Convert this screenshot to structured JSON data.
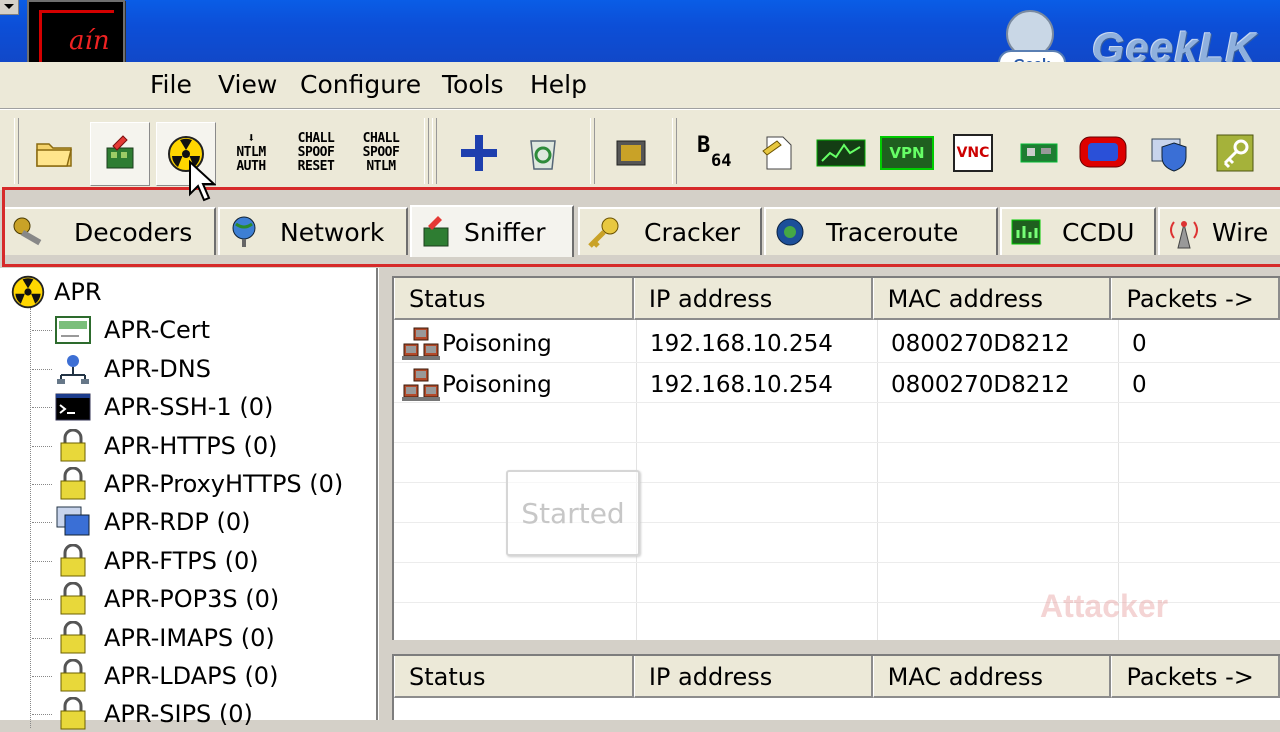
{
  "app": {
    "logo_text": "aín"
  },
  "watermark": {
    "badge": "Geek",
    "brand": "GeekLK"
  },
  "menu": {
    "items": [
      "File",
      "View",
      "Configure",
      "Tools",
      "Help"
    ]
  },
  "toolbar": {
    "buttons": [
      {
        "name": "open-folder",
        "icon": "folder-icon"
      },
      {
        "name": "start-stop-sniffer",
        "icon": "sniffer-icon",
        "pressed": true
      },
      {
        "name": "start-stop-apr",
        "icon": "radiation-icon",
        "pressed": true
      },
      {
        "name": "ntlm-auth",
        "icon": "text-icon",
        "text": [
          "NTLM",
          "AUTH"
        ]
      },
      {
        "name": "chall-spoof-reset",
        "icon": "text-icon",
        "text": [
          "CHALL",
          "SPOOF",
          "RESET"
        ]
      },
      {
        "name": "chall-spoof-ntlm",
        "icon": "text-icon",
        "text": [
          "CHALL",
          "SPOOF",
          "NTLM"
        ]
      },
      {
        "name": "add",
        "icon": "plus-icon"
      },
      {
        "name": "recycle",
        "icon": "recycle-icon"
      },
      {
        "name": "chip",
        "icon": "chip-icon"
      },
      {
        "name": "base64",
        "icon": "b64-icon",
        "text": [
          "B",
          "64"
        ]
      },
      {
        "name": "note",
        "icon": "note-icon"
      },
      {
        "name": "monitor",
        "icon": "monitor-icon"
      },
      {
        "name": "vpn",
        "icon": "vpn-icon",
        "text": [
          "VPN"
        ]
      },
      {
        "name": "vnc",
        "icon": "vnc-icon",
        "text": [
          "VNC"
        ]
      },
      {
        "name": "network-card",
        "icon": "nic-icon"
      },
      {
        "name": "display",
        "icon": "display-icon"
      },
      {
        "name": "shield",
        "icon": "shield-icon"
      },
      {
        "name": "key",
        "icon": "key-icon"
      }
    ]
  },
  "tabs": [
    {
      "label": "Decoders",
      "icon": "decoders-icon"
    },
    {
      "label": "Network",
      "icon": "network-icon"
    },
    {
      "label": "Sniffer",
      "icon": "sniffer-icon",
      "active": true
    },
    {
      "label": "Cracker",
      "icon": "cracker-icon"
    },
    {
      "label": "Traceroute",
      "icon": "traceroute-icon"
    },
    {
      "label": "CCDU",
      "icon": "ccdu-icon"
    },
    {
      "label": "Wire",
      "icon": "wireless-icon"
    }
  ],
  "tree": {
    "root": "APR",
    "items": [
      {
        "label": "APR-Cert",
        "icon": "cert-icon"
      },
      {
        "label": "APR-DNS",
        "icon": "dns-icon"
      },
      {
        "label": "APR-SSH-1 (0)",
        "icon": "terminal-icon"
      },
      {
        "label": "APR-HTTPS (0)",
        "icon": "lock-icon"
      },
      {
        "label": "APR-ProxyHTTPS (0)",
        "icon": "lock-icon"
      },
      {
        "label": "APR-RDP (0)",
        "icon": "rdp-icon"
      },
      {
        "label": "APR-FTPS (0)",
        "icon": "lock-icon"
      },
      {
        "label": "APR-POP3S (0)",
        "icon": "lock-icon"
      },
      {
        "label": "APR-IMAPS (0)",
        "icon": "lock-icon"
      },
      {
        "label": "APR-LDAPS (0)",
        "icon": "lock-icon"
      },
      {
        "label": "APR-SIPS (0)",
        "icon": "lock-icon"
      }
    ]
  },
  "top_table": {
    "columns": [
      "Status",
      "IP address",
      "MAC address",
      "Packets ->"
    ],
    "rows": [
      {
        "status": "Poisoning",
        "ip": "192.168.10.254",
        "mac": "0800270D8212",
        "packets": "0"
      },
      {
        "status": "Poisoning",
        "ip": "192.168.10.254",
        "mac": "0800270D8212",
        "packets": "0"
      }
    ]
  },
  "bottom_table": {
    "columns": [
      "Status",
      "IP address",
      "MAC address",
      "Packets ->"
    ]
  },
  "overlays": {
    "started": "Started",
    "attacker": "Attacker"
  }
}
